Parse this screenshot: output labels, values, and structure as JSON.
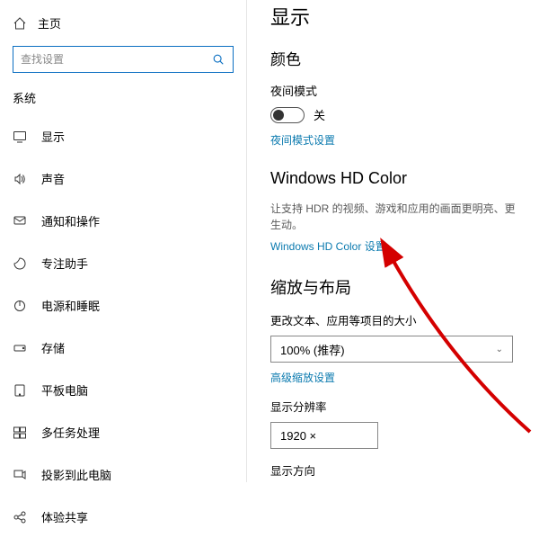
{
  "sidebar": {
    "home": "主页",
    "search_placeholder": "查找设置",
    "group": "系统",
    "items": [
      {
        "label": "显示"
      },
      {
        "label": "声音"
      },
      {
        "label": "通知和操作"
      },
      {
        "label": "专注助手"
      },
      {
        "label": "电源和睡眠"
      },
      {
        "label": "存储"
      },
      {
        "label": "平板电脑"
      },
      {
        "label": "多任务处理"
      },
      {
        "label": "投影到此电脑"
      },
      {
        "label": "体验共享"
      }
    ]
  },
  "main": {
    "title": "显示",
    "color_section": "颜色",
    "night_light_label": "夜间模式",
    "night_light_state": "关",
    "night_light_settings_link": "夜间模式设置",
    "hd_section": "Windows HD Color",
    "hd_desc": "让支持 HDR 的视频、游戏和应用的画面更明亮、更生动。",
    "hd_link": "Windows HD Color 设置",
    "scale_section": "缩放与布局",
    "scale_field_label": "更改文本、应用等项目的大小",
    "scale_value": "100% (推荐)",
    "advanced_scale_link": "高级缩放设置",
    "resolution_label": "显示分辨率",
    "resolution_value": "1920 ×",
    "orientation_label": "显示方向"
  }
}
